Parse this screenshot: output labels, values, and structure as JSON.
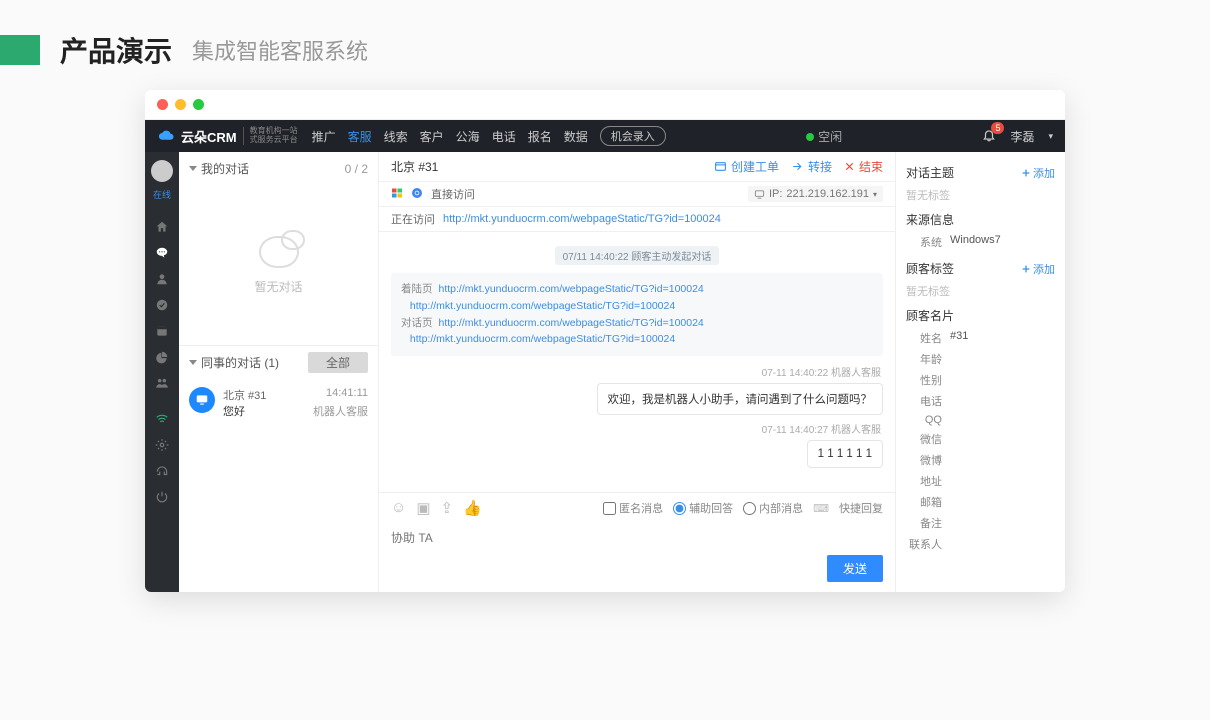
{
  "page": {
    "title": "产品演示",
    "subtitle": "集成智能客服系统"
  },
  "brand": {
    "name": "云朵CRM",
    "tagline1": "教育机构一站",
    "tagline2": "式服务云平台"
  },
  "nav": {
    "items": [
      "推广",
      "客服",
      "线索",
      "客户",
      "公海",
      "电话",
      "报名",
      "数据"
    ],
    "active_index": 1,
    "record_btn": "机会录入",
    "status": "空闲"
  },
  "topright": {
    "badge": "5",
    "user": "李磊"
  },
  "siderail": {
    "status_label": "在线"
  },
  "leftcol": {
    "my_conv": "我的对话",
    "my_count": "0 / 2",
    "empty": "暂无对话",
    "peer_conv": "同事的对话  (1)",
    "all_btn": "全部",
    "item": {
      "name": "北京 #31",
      "time": "14:41:11",
      "last": "您好",
      "by": "机器人客服"
    }
  },
  "mid": {
    "title": "北京 #31",
    "actions": {
      "ticket": "创建工单",
      "transfer": "转接",
      "end": "结束"
    },
    "access": {
      "label": "直接访问"
    },
    "visiting": {
      "label": "正在访问",
      "url": "http://mkt.yunduocrm.com/webpageStatic/TG?id=100024"
    },
    "ip": {
      "label": "IP:",
      "value": "221.219.162.191"
    },
    "sys_notice": "07/11 14:40:22  顾客主动发起对话",
    "links": {
      "row1_label": "着陆页",
      "row1a": "http://mkt.yunduocrm.com/webpageStatic/TG?id=100024",
      "row1b": "http://mkt.yunduocrm.com/webpageStatic/TG?id=100024",
      "row2_label": "对话页",
      "row2a": "http://mkt.yunduocrm.com/webpageStatic/TG?id=100024",
      "row2b": "http://mkt.yunduocrm.com/webpageStatic/TG?id=100024"
    },
    "m1": {
      "time": "07-11 14:40:22  机器人客服",
      "text": "欢迎，我是机器人小助手，请问遇到了什么问题吗？"
    },
    "m2": {
      "time": "07-11 14:40:27  机器人客服",
      "text": "1 1 1 1 1 1"
    },
    "toolbar": {
      "anon": "匿名消息",
      "assist": "辅助回答",
      "internal": "内部消息",
      "quick": "快捷回复"
    },
    "compose": {
      "placeholder": "协助 TA",
      "send": "发送"
    }
  },
  "right": {
    "topic": "对话主题",
    "add": "添加",
    "no_tag": "暂无标签",
    "source": "来源信息",
    "sys_k": "系统",
    "sys_v": "Windows7",
    "cust_tag": "顾客标签",
    "card": "顾客名片",
    "fields": {
      "name_k": "姓名",
      "name_v": "#31",
      "age": "年龄",
      "gender": "性别",
      "phone": "电话",
      "qq": "QQ",
      "wechat": "微信",
      "weibo": "微博",
      "addr": "地址",
      "email": "邮箱",
      "note": "备注",
      "contact": "联系人"
    }
  }
}
